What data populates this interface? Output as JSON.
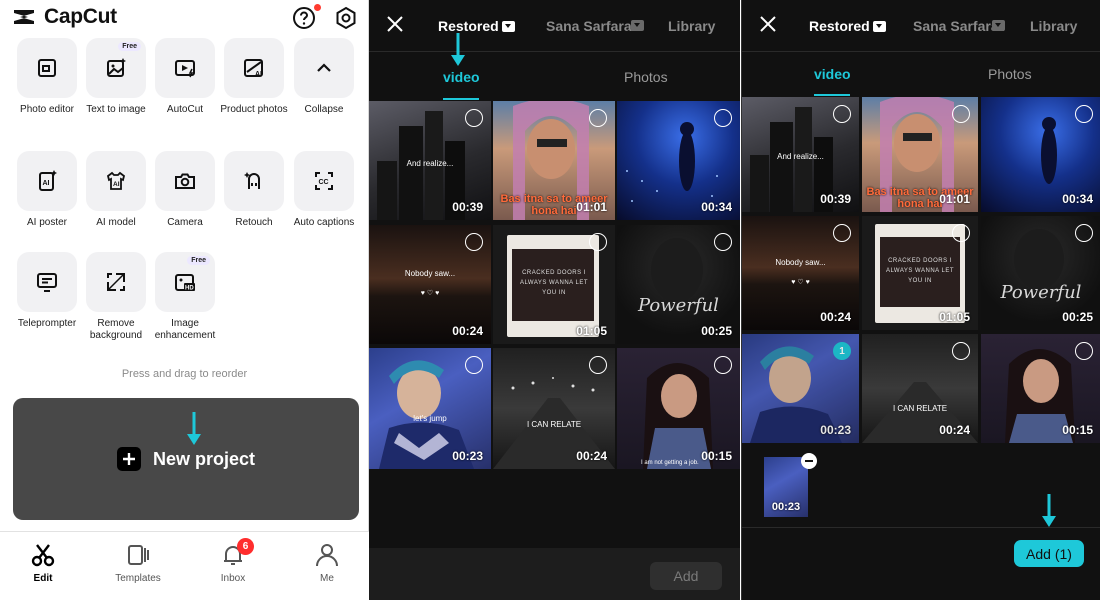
{
  "home": {
    "brand": "CapCut",
    "tools": [
      {
        "label": "Photo editor",
        "icon": "photo-editor-icon"
      },
      {
        "label": "Text to image",
        "icon": "text-to-image-icon",
        "badge": "Free"
      },
      {
        "label": "AutoCut",
        "icon": "autocut-icon"
      },
      {
        "label": "Product photos",
        "icon": "product-photos-icon"
      },
      {
        "label": "Collapse",
        "icon": "chevron-up-icon"
      },
      {
        "label": "AI poster",
        "icon": "ai-poster-icon"
      },
      {
        "label": "AI model",
        "icon": "ai-model-icon"
      },
      {
        "label": "Camera",
        "icon": "camera-icon"
      },
      {
        "label": "Retouch",
        "icon": "retouch-icon"
      },
      {
        "label": "Auto captions",
        "icon": "captions-icon"
      },
      {
        "label": "Teleprompter",
        "icon": "teleprompter-icon"
      },
      {
        "label": "Remove background",
        "icon": "remove-background-icon"
      },
      {
        "label": "Image enhancement",
        "icon": "image-enhancement-icon",
        "badge": "Free"
      }
    ],
    "hint": "Press and drag to reorder",
    "new_project": "New project",
    "nav": [
      {
        "label": "Edit",
        "icon": "scissors-icon",
        "active": true
      },
      {
        "label": "Templates",
        "icon": "templates-icon"
      },
      {
        "label": "Inbox",
        "icon": "bell-icon",
        "badge": "6"
      },
      {
        "label": "Me",
        "icon": "person-icon"
      }
    ]
  },
  "picker": {
    "tabs": [
      "Restored",
      "Sana Sarfaraz",
      "Library"
    ],
    "subtabs": [
      "video",
      "Photos"
    ],
    "items": [
      {
        "duration": "00:39",
        "caption": "And realize..."
      },
      {
        "duration": "01:01",
        "caption": "Bas itna sa to ameer hona hai"
      },
      {
        "duration": "00:34",
        "caption": ""
      },
      {
        "duration": "00:24",
        "caption": "Nobody saw..."
      },
      {
        "duration": "01:05",
        "caption": "CRACKED DOORS I ALWAYS WANNA LET YOU IN"
      },
      {
        "duration": "00:25",
        "caption": "Powerful"
      },
      {
        "duration": "00:23",
        "caption": "let's jump"
      },
      {
        "duration": "00:24",
        "caption": "I CAN RELATE"
      },
      {
        "duration": "00:15",
        "caption": "I am not getting a job."
      }
    ],
    "add_label": "Add",
    "selected_count": "1",
    "add_selected_label": "Add (1)",
    "tray_duration": "00:23"
  },
  "colors": {
    "accent": "#1ec8d9",
    "badge_red": "#ff2d2d"
  }
}
